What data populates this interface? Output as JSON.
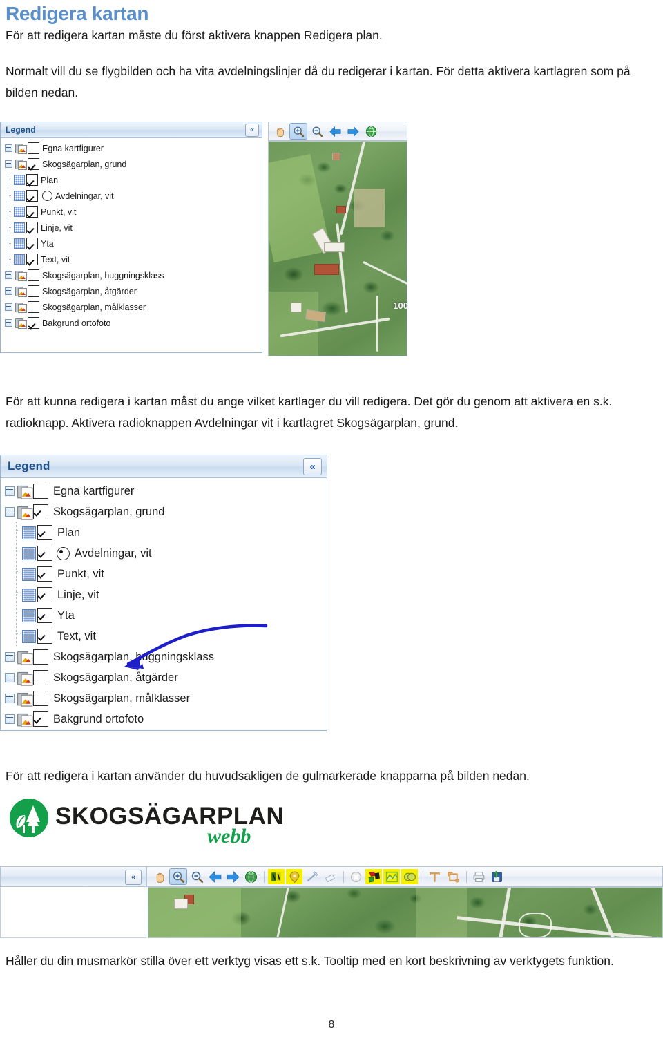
{
  "document": {
    "title": "Redigera kartan",
    "paragraphs": {
      "p1": "För att redigera kartan måste du först aktivera knappen Redigera plan.",
      "p2": "Normalt vill du se flygbilden och ha vita avdelningslinjer då du redigerar i kartan. För detta aktivera kartlagren som på bilden nedan.",
      "p3": "För att kunna redigera i kartan måst du ange vilket kartlager du vill redigera. Det gör du genom att aktivera en s.k. radioknapp. Aktivera radioknappen Avdelningar vit i kartlagret Skogsägarplan, grund.",
      "p4": "För att redigera i kartan använder du huvudsakligen de gulmarkerade knapparna på bilden nedan.",
      "p5": "Håller du din musmarkör stilla över ett verktyg visas ett s.k. Tooltip med en kort beskrivning av verktygets funktion."
    },
    "page_number": "8",
    "title_color": "#5B8FC9"
  },
  "screenshot1": {
    "legend": {
      "title": "Legend",
      "collapse_icon": "chevron-double-left-icon",
      "rows": [
        {
          "label": "Egna kartfigurer",
          "type": "group",
          "expander": "plus",
          "checked": false,
          "radio": null
        },
        {
          "label": "Skogsägarplan, grund",
          "type": "group",
          "expander": "minus",
          "checked": true,
          "radio": null
        },
        {
          "label": "Plan",
          "type": "child",
          "expander": null,
          "checked": true,
          "radio": null
        },
        {
          "label": "Avdelningar, vit",
          "type": "child",
          "expander": null,
          "checked": true,
          "radio": "off"
        },
        {
          "label": "Punkt, vit",
          "type": "child",
          "expander": null,
          "checked": true,
          "radio": null
        },
        {
          "label": "Linje, vit",
          "type": "child",
          "expander": null,
          "checked": true,
          "radio": null
        },
        {
          "label": "Yta",
          "type": "child",
          "expander": null,
          "checked": true,
          "radio": null
        },
        {
          "label": "Text, vit",
          "type": "child",
          "expander": null,
          "checked": true,
          "radio": null
        },
        {
          "label": "Skogsägarplan, huggningsklass",
          "type": "group",
          "expander": "plus",
          "checked": false,
          "radio": null
        },
        {
          "label": "Skogsägarplan, åtgärder",
          "type": "group",
          "expander": "plus",
          "checked": false,
          "radio": null
        },
        {
          "label": "Skogsägarplan, målklasser",
          "type": "group",
          "expander": "plus",
          "checked": false,
          "radio": null
        },
        {
          "label": "Bakgrund ortofoto",
          "type": "group",
          "expander": "plus",
          "checked": true,
          "radio": null
        }
      ]
    },
    "toolbar": {
      "tools": [
        {
          "name": "pan-hand-icon",
          "selected": false,
          "highlighted": false
        },
        {
          "name": "zoom-in-icon",
          "selected": true,
          "highlighted": false
        },
        {
          "name": "zoom-out-icon",
          "selected": false,
          "highlighted": false
        },
        {
          "name": "back-arrow-icon",
          "selected": false,
          "highlighted": false
        },
        {
          "name": "forward-arrow-icon",
          "selected": false,
          "highlighted": false
        },
        {
          "name": "globe-full-extent-icon",
          "selected": false,
          "highlighted": false
        }
      ]
    },
    "map": {
      "scale_label": "100"
    }
  },
  "screenshot2": {
    "legend": {
      "title": "Legend",
      "collapse_icon": "chevron-double-left-icon",
      "rows": [
        {
          "label": "Egna kartfigurer",
          "type": "group",
          "expander": "plus",
          "checked": false,
          "radio": null
        },
        {
          "label": "Skogsägarplan, grund",
          "type": "group",
          "expander": "minus",
          "checked": true,
          "radio": null
        },
        {
          "label": "Plan",
          "type": "child",
          "expander": null,
          "checked": true,
          "radio": null
        },
        {
          "label": "Avdelningar, vit",
          "type": "child",
          "expander": null,
          "checked": true,
          "radio": "on"
        },
        {
          "label": "Punkt, vit",
          "type": "child",
          "expander": null,
          "checked": true,
          "radio": null
        },
        {
          "label": "Linje, vit",
          "type": "child",
          "expander": null,
          "checked": true,
          "radio": null
        },
        {
          "label": "Yta",
          "type": "child",
          "expander": null,
          "checked": true,
          "radio": null
        },
        {
          "label": "Text, vit",
          "type": "child",
          "expander": null,
          "checked": true,
          "radio": null
        },
        {
          "label": "Skogsägarplan, huggningsklass",
          "type": "group",
          "expander": "plus",
          "checked": false,
          "radio": null
        },
        {
          "label": "Skogsägarplan, åtgärder",
          "type": "group",
          "expander": "plus",
          "checked": false,
          "radio": null
        },
        {
          "label": "Skogsägarplan, målklasser",
          "type": "group",
          "expander": "plus",
          "checked": false,
          "radio": null
        },
        {
          "label": "Bakgrund ortofoto",
          "type": "group",
          "expander": "plus",
          "checked": true,
          "radio": null
        }
      ]
    },
    "annotation": {
      "name": "blue-arrow-annotation",
      "color": "#1a1ac4",
      "points_to": "Avdelningar, vit radio button"
    }
  },
  "screenshot3": {
    "logo": {
      "brand": "SKOGSÄGARPLAN",
      "sub": "webb",
      "green": "#14a04a",
      "mark": "tree-leaf-logo-icon"
    },
    "left_panel": {
      "collapse_icon": "chevron-double-left-icon"
    },
    "toolbar": {
      "highlight_color": "#f5f000",
      "tools": [
        {
          "name": "pan-hand-icon",
          "selected": false,
          "highlighted": false
        },
        {
          "name": "zoom-in-icon",
          "selected": true,
          "highlighted": false
        },
        {
          "name": "zoom-out-icon",
          "selected": false,
          "highlighted": false
        },
        {
          "name": "back-arrow-icon",
          "selected": false,
          "highlighted": false
        },
        {
          "name": "forward-arrow-icon",
          "selected": false,
          "highlighted": false
        },
        {
          "name": "globe-full-extent-icon",
          "selected": false,
          "highlighted": false
        },
        {
          "name": "separator",
          "selected": false,
          "highlighted": false
        },
        {
          "name": "select-feature-icon",
          "selected": false,
          "highlighted": true
        },
        {
          "name": "info-identify-icon",
          "selected": false,
          "highlighted": true
        },
        {
          "name": "draw-line-icon",
          "selected": false,
          "highlighted": false
        },
        {
          "name": "eraser-icon",
          "selected": false,
          "highlighted": false
        },
        {
          "name": "separator",
          "selected": false,
          "highlighted": false
        },
        {
          "name": "clear-selection-icon",
          "selected": false,
          "highlighted": false
        },
        {
          "name": "edit-polygon-icon",
          "selected": false,
          "highlighted": true
        },
        {
          "name": "split-area-icon",
          "selected": false,
          "highlighted": true
        },
        {
          "name": "merge-area-icon",
          "selected": false,
          "highlighted": true
        },
        {
          "name": "separator",
          "selected": false,
          "highlighted": false
        },
        {
          "name": "measure-distance-icon",
          "selected": false,
          "highlighted": false
        },
        {
          "name": "measure-area-icon",
          "selected": false,
          "highlighted": false
        },
        {
          "name": "separator",
          "selected": false,
          "highlighted": false
        },
        {
          "name": "print-icon",
          "selected": false,
          "highlighted": false
        },
        {
          "name": "save-icon",
          "selected": false,
          "highlighted": false
        }
      ]
    }
  }
}
